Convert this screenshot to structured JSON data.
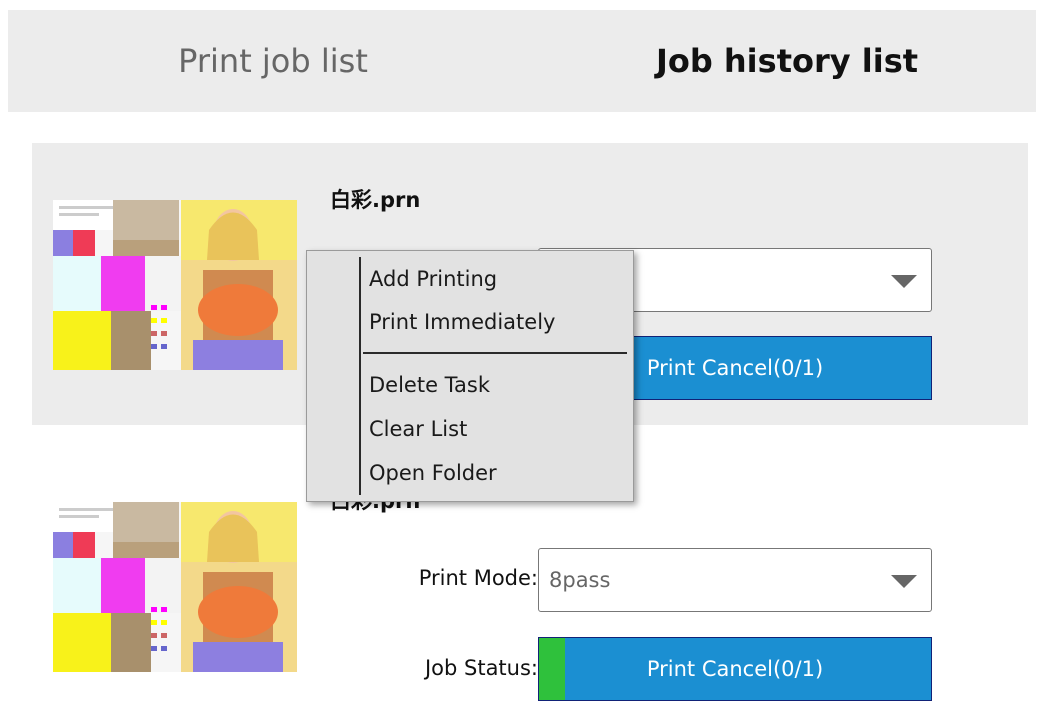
{
  "tabs": {
    "print_job_list": "Print job list",
    "job_history_list": "Job history list"
  },
  "jobs": [
    {
      "filename": "白彩.prn",
      "print_mode_label": "",
      "print_mode_value": "",
      "job_status_label": "",
      "status_button": "Print Cancel(0/1)",
      "progress_fraction": 0.0
    },
    {
      "filename": "白彩.prn",
      "print_mode_label": "Print Mode:",
      "print_mode_value": "8pass",
      "job_status_label": "Job Status:",
      "status_button": "Print Cancel(0/1)",
      "progress_fraction": 0.0
    }
  ],
  "context_menu": {
    "items": [
      "Add Printing",
      "Print Immediately",
      "Delete Task",
      "Clear List",
      "Open Folder"
    ]
  },
  "colors": {
    "status_blue": "#1b8fd2",
    "progress_green": "#2fc13c",
    "tab_bg": "#ececec"
  }
}
